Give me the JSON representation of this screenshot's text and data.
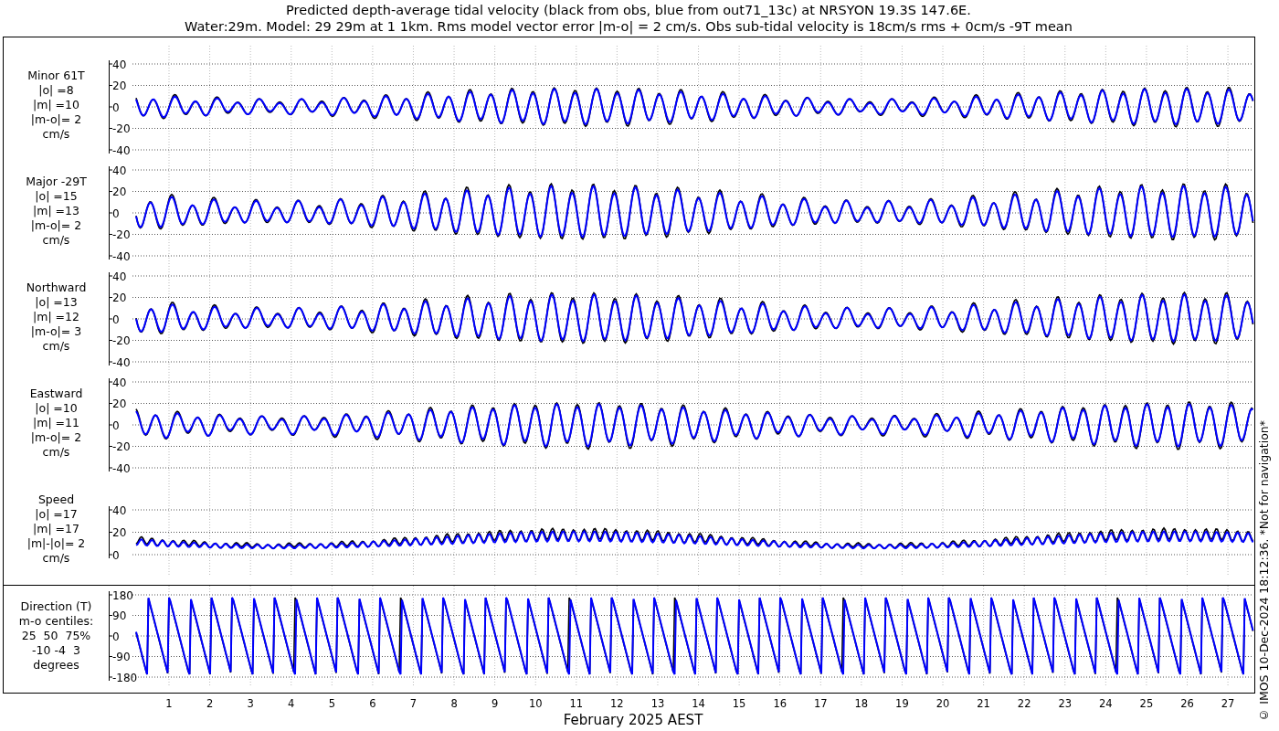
{
  "title": [
    "Predicted depth-average tidal velocity (black from obs, blue from out71_13c) at NRSYON 19.3S 147.6E.",
    "Water:29m. Model: 29 29m at 1 1km. Rms model vector error |m-o| = 2 cm/s. Obs sub-tidal velocity is 18cm/s rms + 0cm/s -9T mean"
  ],
  "panels": [
    {
      "kind": "velocity",
      "label": [
        "Minor 61T",
        "|o| =8",
        "|m| =10",
        "|m-o|= 2",
        "cm/s"
      ],
      "yticks": [
        "40",
        "20",
        "0",
        "-20",
        "-40"
      ]
    },
    {
      "kind": "velocity",
      "label": [
        "Major -29T",
        "|o| =15",
        "|m| =13",
        "|m-o|= 2",
        "cm/s"
      ],
      "yticks": [
        "40",
        "20",
        "0",
        "-20",
        "-40"
      ]
    },
    {
      "kind": "velocity",
      "label": [
        "Northward",
        "|o| =13",
        "|m| =12",
        "|m-o|= 3",
        "cm/s"
      ],
      "yticks": [
        "40",
        "20",
        "0",
        "-20",
        "-40"
      ]
    },
    {
      "kind": "velocity",
      "label": [
        "Eastward",
        "|o| =10",
        "|m| =11",
        "|m-o|= 2",
        "cm/s"
      ],
      "yticks": [
        "40",
        "20",
        "0",
        "-20",
        "-40"
      ]
    },
    {
      "kind": "speed",
      "label": [
        "Speed",
        "|o| =17",
        "|m| =17",
        "|m|-|o|= 2",
        "cm/s"
      ],
      "yticks": [
        "40",
        "20",
        "0"
      ]
    },
    {
      "kind": "direction",
      "label": [
        "Direction (T)",
        "m-o centiles:",
        "25  50  75%",
        "-10 -4  3",
        "degrees"
      ],
      "yticks": [
        "180",
        "90",
        "0",
        "-90",
        "-180"
      ]
    }
  ],
  "xticks": [
    "1",
    "2",
    "3",
    "4",
    "5",
    "6",
    "7",
    "8",
    "9",
    "10",
    "11",
    "12",
    "13",
    "14",
    "15",
    "16",
    "17",
    "18",
    "19",
    "20",
    "21",
    "22",
    "23",
    "24",
    "25",
    "26",
    "27"
  ],
  "xlabel": "February 2025 AEST",
  "credit": "© IMOS 10-Dec-2024 18:12:36. *Not for navigation*"
}
